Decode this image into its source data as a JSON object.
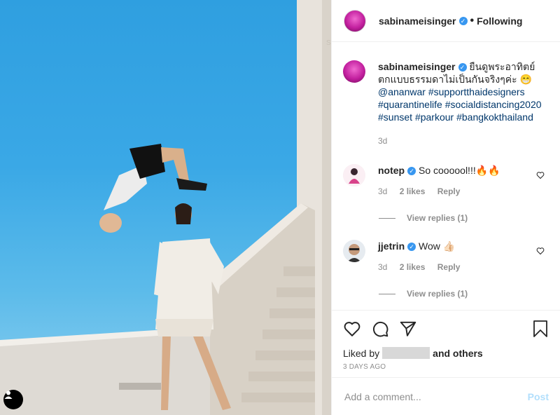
{
  "post": {
    "username": "sabinameisinger",
    "verified_icon": "verified-badge-icon",
    "separator": "•",
    "follow_status": "Following"
  },
  "caption": {
    "username": "sabinameisinger",
    "text": "ยืนดูพระอาทิตย์ตกแบบธรรมดาไม่เป็นกันจริงๆค่ะ 😁",
    "mention": "@ananwar",
    "hashtags": [
      "#supportthaidesigners",
      "#quarantinelife",
      "#socialdistancing2020",
      "#sunset",
      "#parkour",
      "#bangkokthailand"
    ],
    "age": "3d"
  },
  "comments": [
    {
      "username": "notep",
      "text": "So coooool!!!🔥🔥",
      "age": "3d",
      "likes": "2 likes",
      "reply": "Reply",
      "view_replies": "View replies (1)"
    },
    {
      "username": "jjetrin",
      "text": "Wow 👍🏻",
      "age": "3d",
      "likes": "2 likes",
      "reply": "Reply",
      "view_replies": "View replies (1)"
    }
  ],
  "actions": {
    "liked_prefix": "Liked by",
    "liked_suffix": "and others",
    "timestamp": "3 DAYS AGO"
  },
  "add_comment": {
    "placeholder": "Add a comment...",
    "post_label": "Post"
  },
  "colors": {
    "link": "#00376b",
    "verified": "#3897f0",
    "post_disabled": "#b2dffc"
  }
}
